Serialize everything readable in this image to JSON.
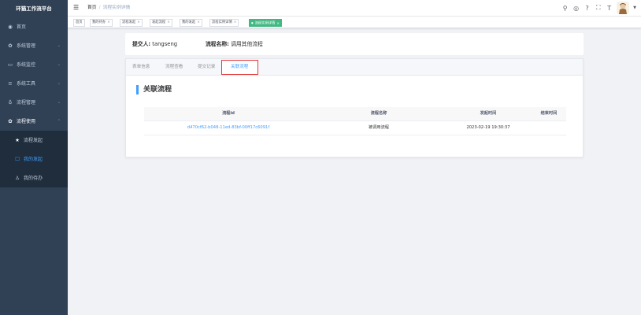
{
  "app": {
    "title": "环猫工作流平台"
  },
  "sidebar": {
    "items": [
      {
        "label": "首页",
        "icon": "dashboard-icon"
      },
      {
        "label": "系统管理",
        "icon": "gear-icon"
      },
      {
        "label": "系统监控",
        "icon": "monitor-icon"
      },
      {
        "label": "系统工具",
        "icon": "tool-icon"
      },
      {
        "label": "流程管理",
        "icon": "process-icon"
      },
      {
        "label": "流程使用",
        "icon": "gear-icon"
      }
    ],
    "sub_items": [
      {
        "label": "流程发起",
        "icon": "star-icon"
      },
      {
        "label": "我的发起",
        "icon": "edit-icon"
      },
      {
        "label": "我的待办",
        "icon": "person-icon"
      }
    ]
  },
  "navbar": {
    "breadcrumb": [
      "首页",
      "流程实例详情"
    ],
    "icons": [
      "search-icon",
      "github-icon",
      "question-icon",
      "fullscreen-icon",
      "font-size-icon"
    ]
  },
  "tags": [
    "首页",
    "我的待办",
    "流程发起",
    "发起流程",
    "我的发起",
    "流程实例详情",
    "流程实例详情"
  ],
  "detail": {
    "submitter_label": "提交人:",
    "submitter_value": "tangseng",
    "process_name_label": "流程名称:",
    "process_name_value": "调用其他流程"
  },
  "tabs": [
    "表单信息",
    "流程查看",
    "提交记录",
    "关联流程"
  ],
  "section": {
    "title": "关联流程"
  },
  "table": {
    "headers": [
      "流程id",
      "流程名称",
      "发起时间",
      "结束时间"
    ],
    "rows": [
      [
        "d470cf62-b048-11ed-83bf-00ff17c6091f",
        "被调用流程",
        "2023-02-19 19:30:37",
        ""
      ]
    ]
  },
  "colors": {
    "sidebar_bg": "#304156",
    "accent": "#409eff",
    "tag_active": "#42b983",
    "highlight_box": "#e53935"
  }
}
